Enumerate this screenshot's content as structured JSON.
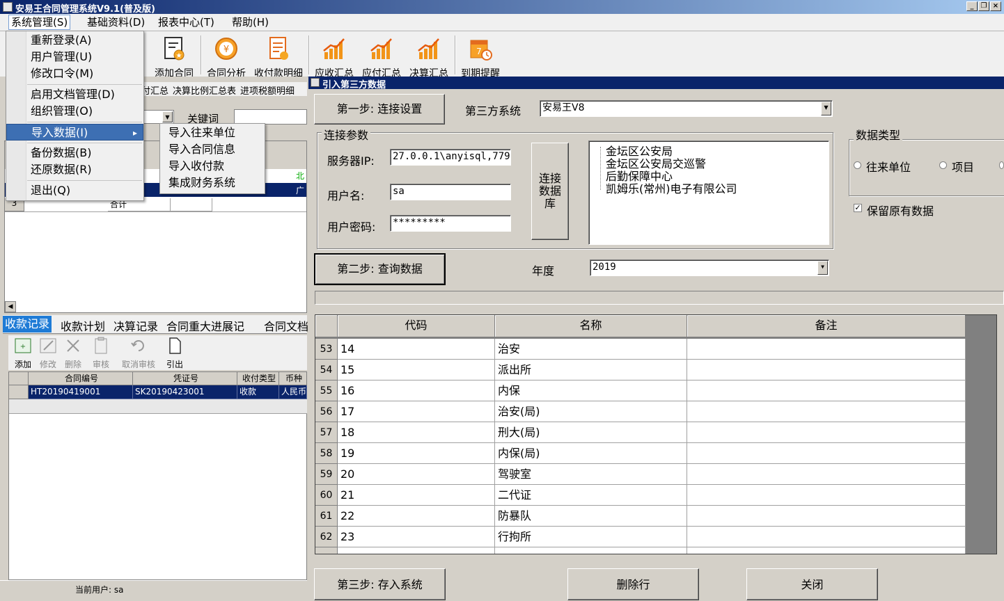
{
  "window": {
    "title": "安易王合同管理系统V9.1(普及版)"
  },
  "menubar": [
    "系统管理(S)",
    "基础资料(D)",
    "报表中心(T)",
    "帮助(H)"
  ],
  "toolbar": [
    "添加合同",
    "合同分析",
    "收付款明细",
    "应收汇总",
    "应付汇总",
    "决算汇总",
    "到期提醒"
  ],
  "left": {
    "tabs_top": [
      "付汇总",
      "决算比例汇总表",
      "进项税额明细"
    ],
    "keyword_label": "关键词",
    "grid_row3_num": "3",
    "grid_row3_text": "合计",
    "fragment_1": "北",
    "fragment_2": "广",
    "tabs": [
      "收款记录",
      "收款计划",
      "决算记录",
      "合同重大进展记",
      "合同文档"
    ],
    "toolbar2": [
      "添加",
      "修改",
      "删除",
      "审核",
      "取消审核",
      "引出"
    ],
    "table": {
      "headers": [
        "合同编号",
        "凭证号",
        "收付类型",
        "币种"
      ],
      "row": [
        "HT20190419001",
        "SK20190423001",
        "收款",
        "人民币"
      ]
    },
    "status_user": "当前用户: sa"
  },
  "menu_dropdown": {
    "items": [
      "重新登录(A)",
      "用户管理(U)",
      "修改口令(M)",
      "启用文档管理(D)",
      "组织管理(O)",
      "导入数据(I)",
      "备份数据(B)",
      "还原数据(R)",
      "退出(Q)"
    ],
    "submenu_arrow": "▸",
    "submenu": [
      "导入往来单位",
      "导入合同信息",
      "导入收付款",
      "集成财务系统"
    ]
  },
  "dialog": {
    "title": "引入第三方数据",
    "step1": "第一步: 连接设置",
    "third_party_label": "第三方系统",
    "third_party_value": "安易王V8",
    "conn_group": "连接参数",
    "server_label": "服务器IP:",
    "server_value": "27.0.0.1\\anyisql,7799",
    "user_label": "用户名:",
    "user_value": "sa",
    "pwd_label": "用户密码:",
    "pwd_value": "*********",
    "connect_btn": "连接数据库",
    "tree": [
      "金坛区公安局",
      "金坛区公安局交巡警",
      "后勤保障中心",
      "凯姆乐(常州)电子有限公司"
    ],
    "datatype_group": "数据类型",
    "radio_units": "往来单位",
    "radio_project": "项目",
    "keep_data": "保留原有数据",
    "checkmark": "✓",
    "step2": "第二步: 查询数据",
    "year_label": "年度",
    "year_value": "2019",
    "grid_headers": [
      "代码",
      "名称",
      "备注"
    ],
    "rows": [
      {
        "n": "53",
        "code": "14",
        "name": "治安",
        "note": ""
      },
      {
        "n": "54",
        "code": "15",
        "name": "派出所",
        "note": ""
      },
      {
        "n": "55",
        "code": "16",
        "name": "内保",
        "note": ""
      },
      {
        "n": "56",
        "code": "17",
        "name": "治安(局)",
        "note": ""
      },
      {
        "n": "57",
        "code": "18",
        "name": "刑大(局)",
        "note": ""
      },
      {
        "n": "58",
        "code": "19",
        "name": "内保(局)",
        "note": ""
      },
      {
        "n": "59",
        "code": "20",
        "name": "驾驶室",
        "note": ""
      },
      {
        "n": "60",
        "code": "21",
        "name": "二代证",
        "note": ""
      },
      {
        "n": "61",
        "code": "22",
        "name": "防暴队",
        "note": ""
      },
      {
        "n": "62",
        "code": "23",
        "name": "行拘所",
        "note": ""
      }
    ],
    "step3": "第三步: 存入系统",
    "delete_btn": "删除行",
    "close_btn": "关闭"
  }
}
